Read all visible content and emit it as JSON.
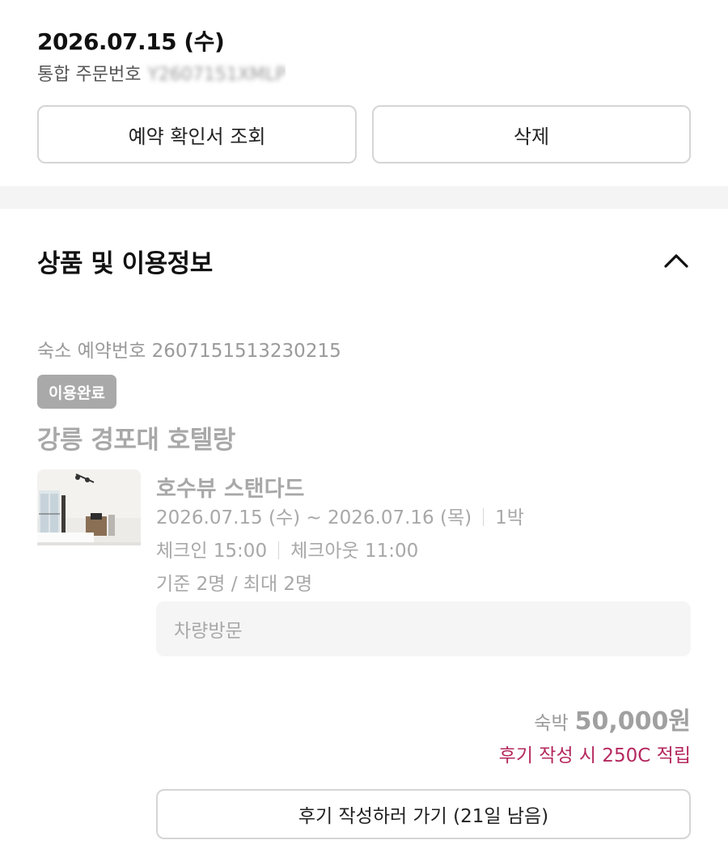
{
  "order": {
    "date": "2026.07.15 (수)",
    "number_label": "통합 주문번호",
    "number_masked": "Y2607151XMLP"
  },
  "actions": {
    "confirm_label": "예약 확인서 조회",
    "delete_label": "삭제"
  },
  "section": {
    "title": "상품 및 이용정보",
    "toggle_icon": "chevron-up-icon"
  },
  "reservation": {
    "number_text": "숙소 예약번호 2607151513230215",
    "status": "이용완료",
    "hotel_name": "강릉 경포대 호텔랑",
    "room_name": "호수뷰 스탠다드",
    "dates": "2026.07.15 (수) ~ 2026.07.16 (목)",
    "nights": "1박",
    "checkin": "체크인 15:00",
    "checkout": "체크아웃 11:00",
    "occupancy": "기준 2명 / 최대 2명",
    "visit_method": "차량방문"
  },
  "price": {
    "label": "숙박",
    "value": "50,000원",
    "reward_note": "후기 작성 시 250C 적립"
  },
  "review": {
    "button_label": "후기 작성하러 가기 (21일 남음)"
  },
  "colors": {
    "accent": "#b5285e",
    "badge_bg": "#a9a9a9",
    "muted_text": "#a8a8a8"
  }
}
